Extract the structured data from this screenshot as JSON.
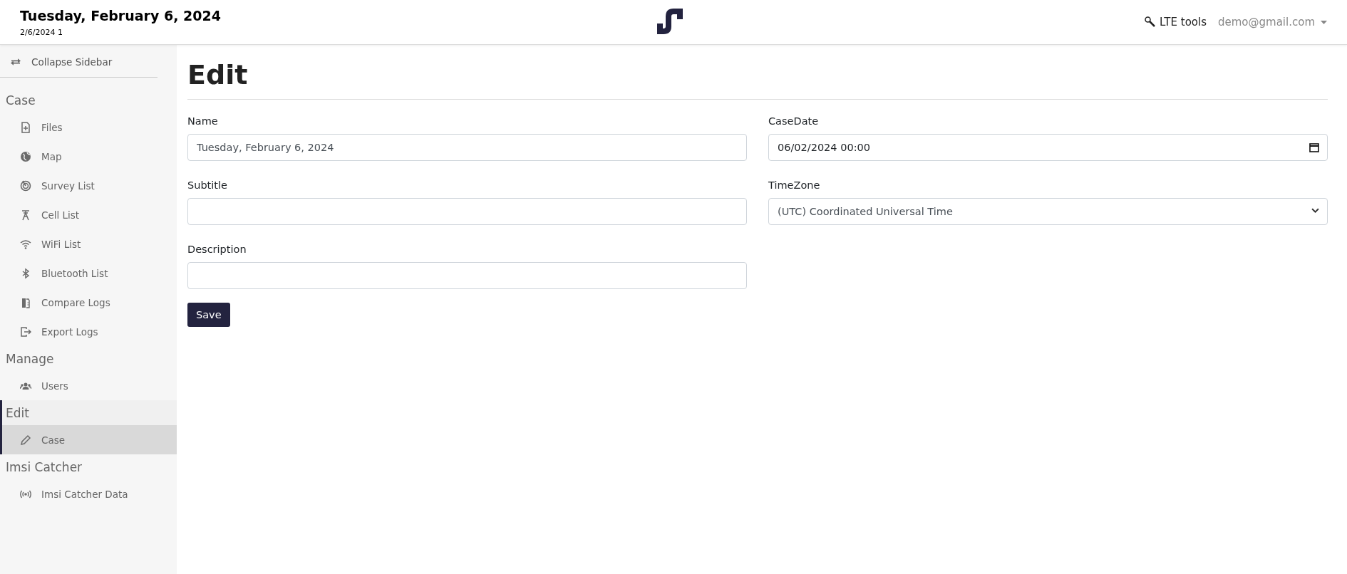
{
  "header": {
    "title": "Tuesday, February 6, 2024",
    "subtitle": "2/6/2024 1",
    "tools_link": "LTE tools",
    "user_menu": "demo@gmail.com"
  },
  "sidebar": {
    "collapse": "Collapse Sidebar",
    "sections": [
      {
        "heading": "Case",
        "selected": false,
        "items": [
          {
            "label": "Files",
            "selected": false
          },
          {
            "label": "Map",
            "selected": false
          },
          {
            "label": "Survey List",
            "selected": false
          },
          {
            "label": "Cell List",
            "selected": false
          },
          {
            "label": "WiFi List",
            "selected": false
          },
          {
            "label": "Bluetooth List",
            "selected": false
          },
          {
            "label": "Compare Logs",
            "selected": false
          },
          {
            "label": "Export Logs",
            "selected": false
          }
        ]
      },
      {
        "heading": "Manage",
        "selected": false,
        "items": [
          {
            "label": "Users",
            "selected": false
          }
        ]
      },
      {
        "heading": "Edit",
        "selected": true,
        "items": [
          {
            "label": "Case",
            "selected": true
          }
        ]
      },
      {
        "heading": "Imsi Catcher",
        "selected": false,
        "items": [
          {
            "label": "Imsi Catcher Data",
            "selected": false
          }
        ]
      }
    ]
  },
  "page": {
    "title": "Edit",
    "left_fields": [
      {
        "label": "Name",
        "kind": "text",
        "value": "Tuesday, February 6, 2024"
      },
      {
        "label": "Subtitle",
        "kind": "text"
      },
      {
        "label": "Description",
        "kind": "text"
      }
    ],
    "right_fields": [
      {
        "label": "CaseDate",
        "kind": "datetime",
        "value": "06/02/2024 00:00"
      },
      {
        "label": "TimeZone",
        "kind": "select",
        "value": "(UTC) Coordinated Universal Time"
      }
    ],
    "save_button": "Save"
  }
}
